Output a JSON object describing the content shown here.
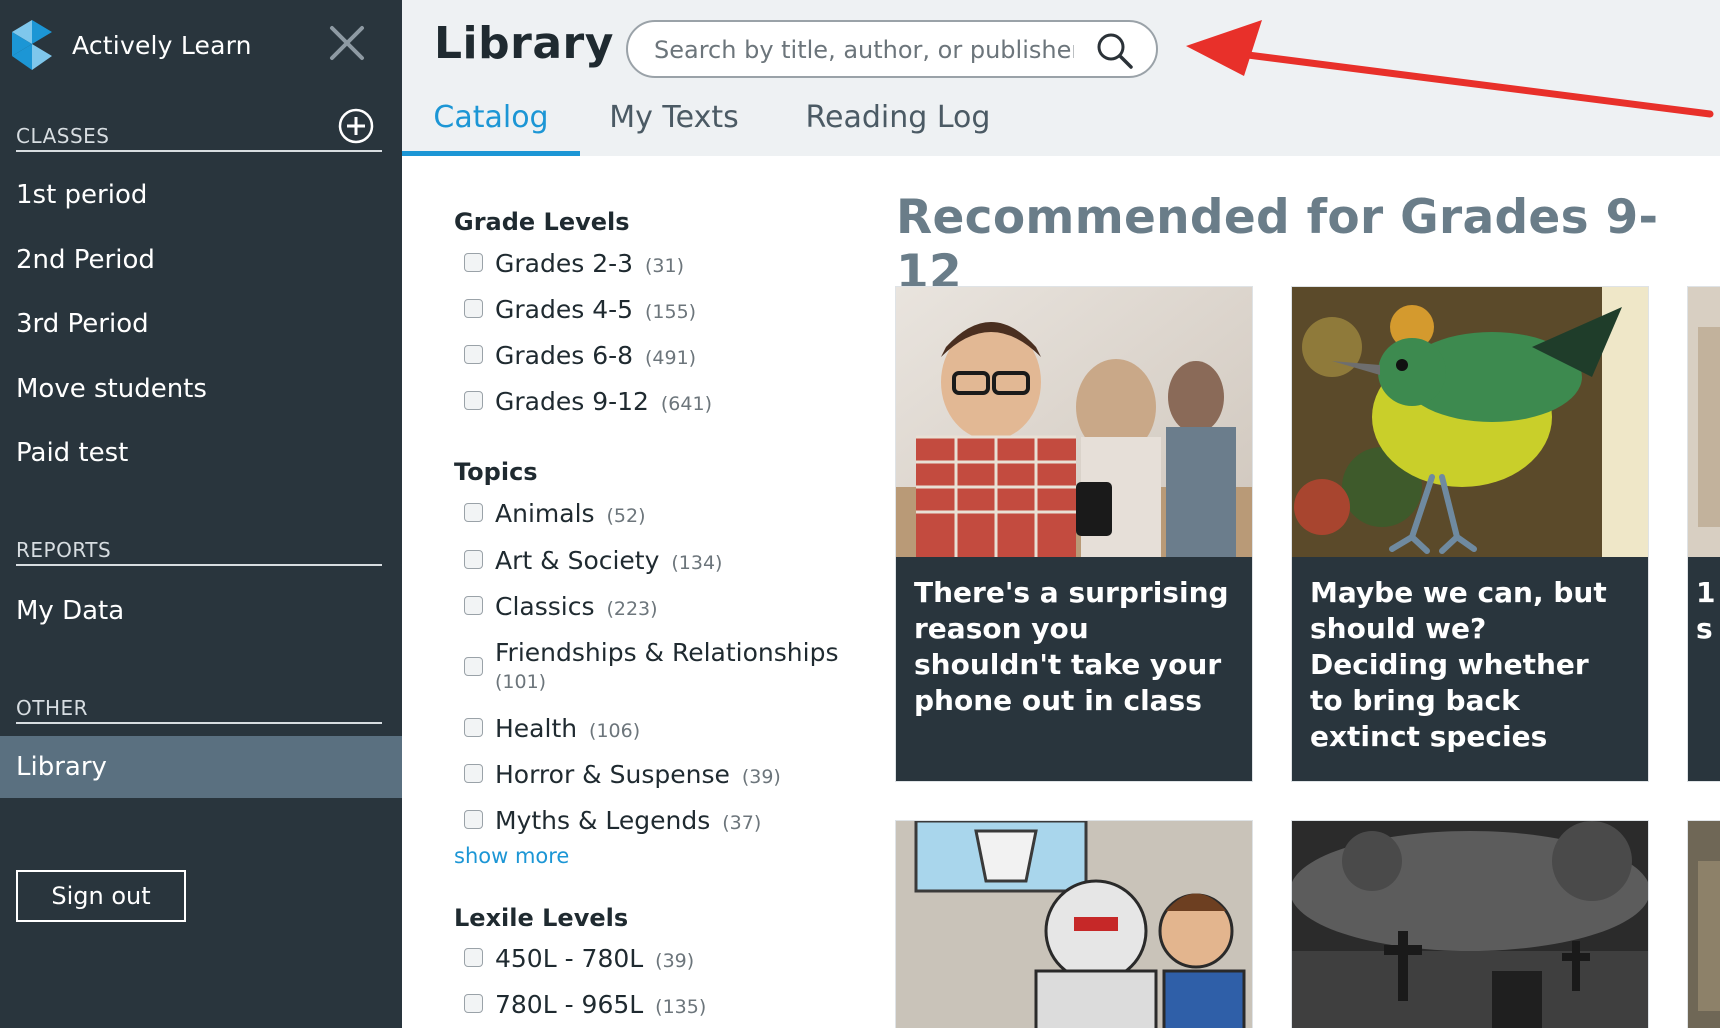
{
  "sidebar": {
    "brand": "Actively Learn",
    "sections": {
      "classes": "CLASSES",
      "reports": "REPORTS",
      "other": "OTHER"
    },
    "classes": [
      "1st period",
      "2nd Period",
      "3rd Period",
      "Move students",
      "Paid test"
    ],
    "reports": [
      "My Data"
    ],
    "other": [
      "Library"
    ],
    "sign_out": "Sign out"
  },
  "header": {
    "title": "Library",
    "search_placeholder": "Search by title, author, or publisher",
    "tabs": [
      "Catalog",
      "My Texts",
      "Reading Log"
    ],
    "active_tab": "Catalog"
  },
  "filters": {
    "grade_levels": {
      "title": "Grade Levels",
      "items": [
        {
          "label": "Grades 2-3",
          "count": "(31)"
        },
        {
          "label": "Grades 4-5",
          "count": "(155)"
        },
        {
          "label": "Grades 6-8",
          "count": "(491)"
        },
        {
          "label": "Grades 9-12",
          "count": "(641)"
        }
      ]
    },
    "topics": {
      "title": "Topics",
      "items": [
        {
          "label": "Animals",
          "count": "(52)"
        },
        {
          "label": "Art & Society",
          "count": "(134)"
        },
        {
          "label": "Classics",
          "count": "(223)"
        },
        {
          "label": "Friendships & Relationships",
          "count": "(101)"
        },
        {
          "label": "Health",
          "count": "(106)"
        },
        {
          "label": "Horror & Suspense",
          "count": "(39)"
        },
        {
          "label": "Myths & Legends",
          "count": "(37)"
        }
      ],
      "show_more": "show more"
    },
    "lexile_levels": {
      "title": "Lexile Levels",
      "items": [
        {
          "label": "450L - 780L",
          "count": "(39)"
        },
        {
          "label": "780L - 965L",
          "count": "(135)"
        }
      ]
    }
  },
  "main": {
    "title": "Recommended for Grades 9-12",
    "cards": [
      {
        "title": "There's a surprising reason you shouldn't take your phone out in class"
      },
      {
        "title": "Maybe we can, but should we? Deciding whether to bring back extinct species"
      },
      {
        "title": "1\ns"
      }
    ]
  },
  "colors": {
    "sidebar_bg": "#29353d",
    "sidebar_active": "#5a7080",
    "accent": "#1c96d5",
    "annotation_arrow": "#e8302a"
  }
}
